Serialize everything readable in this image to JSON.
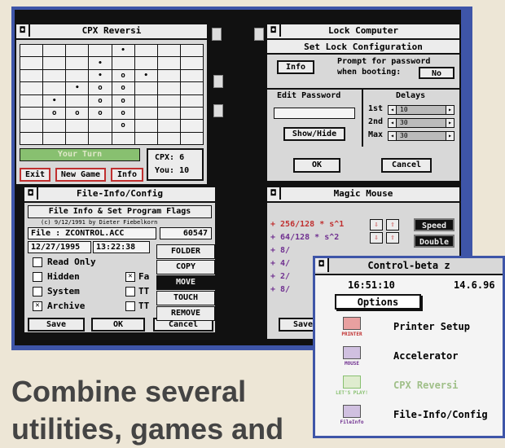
{
  "reversi": {
    "title": "CPX Reversi",
    "board": [
      [
        "",
        "",
        "",
        "",
        "•",
        "",
        "",
        ""
      ],
      [
        "",
        "",
        "",
        "•",
        "",
        "",
        "",
        ""
      ],
      [
        "",
        "",
        "",
        "•",
        "o",
        "•",
        "",
        ""
      ],
      [
        "",
        "",
        "•",
        "o",
        "o",
        "",
        "",
        ""
      ],
      [
        "",
        "•",
        "",
        "o",
        "o",
        "",
        "",
        ""
      ],
      [
        "",
        "o",
        "o",
        "o",
        "o",
        "",
        "",
        ""
      ],
      [
        "",
        "",
        "",
        "",
        "o",
        "",
        "",
        ""
      ],
      [
        "",
        "",
        "",
        "",
        "",
        "",
        "",
        ""
      ]
    ],
    "turn_text": "Your Turn",
    "cpx_score": "CPX: 6",
    "you_score": "You: 10",
    "buttons": {
      "exit": "Exit",
      "new_game": "New Game",
      "info": "Info"
    }
  },
  "lock": {
    "title": "Lock Computer",
    "subtitle": "Set Lock Configuration",
    "info_button": "Info",
    "prompt_line1": "Prompt for password",
    "prompt_line2": "when booting:",
    "prompt_value": "No",
    "edit_password_header": "Edit Password",
    "show_hide_button": "Show/Hide",
    "delays_header": "Delays",
    "delay_rows": [
      {
        "label": "1st",
        "value": "10"
      },
      {
        "label": "2nd",
        "value": "30"
      },
      {
        "label": "Max",
        "value": "30"
      }
    ],
    "ok_button": "OK",
    "cancel_button": "Cancel"
  },
  "fileinfo": {
    "title": "File-Info/Config",
    "subtitle": "File Info & Set Program Flags",
    "copyright": "(c) 9/12/1991 by Dieter Fiebelkorn",
    "file_label": "File : ZCONTROL.ACC",
    "file_size": "60547",
    "date": "12/27/1995",
    "time": "13:22:38",
    "flags": [
      {
        "label": "Read Only",
        "checked": false
      },
      {
        "label": "Hidden",
        "checked": false
      },
      {
        "label": "System",
        "checked": false
      },
      {
        "label": "Archive",
        "checked": true
      }
    ],
    "flags2": [
      {
        "label": "Fa",
        "checked": true
      },
      {
        "label": "TT",
        "checked": false
      },
      {
        "label": "TT",
        "checked": false
      }
    ],
    "save_button": "Save",
    "ok_button": "OK",
    "cancel_button": "Cancel",
    "menu": [
      "FOLDER",
      "COPY",
      "MOVE",
      "TOUCH",
      "REMOVE"
    ],
    "menu_selected": "MOVE"
  },
  "magic": {
    "title": "Magic Mouse",
    "rows": [
      {
        "text": "+ 256/128 * s^1"
      },
      {
        "text": "+  64/128 * s^2"
      },
      {
        "text": "+   8/"
      },
      {
        "text": "+   4/"
      },
      {
        "text": "+   2/"
      },
      {
        "text": "+   8/"
      }
    ],
    "speed_button": "Speed",
    "double_button": "Double",
    "save_button": "Save"
  },
  "control": {
    "title": "Control-beta  z",
    "time": "16:51:10",
    "date": "14.6.96",
    "options_button": "Options",
    "items": [
      {
        "label": "Printer Setup",
        "icon_label": "PRINTER",
        "icon": "printer-icon",
        "dimmed": false
      },
      {
        "label": "Accelerator",
        "icon_label": "MOUSE",
        "icon": "mouse-icon",
        "dimmed": false
      },
      {
        "label": "CPX Reversi",
        "icon_label": "LET'S PLAY!",
        "icon": "reversi-board-icon",
        "dimmed": true
      },
      {
        "label": "File-Info/Config",
        "icon_label": "FileInfo",
        "icon": "file-info-icon",
        "dimmed": false
      }
    ]
  },
  "caption": {
    "line1": "Combine several",
    "line2": "utilities, games and"
  },
  "colors": {
    "frame_blue": "#3e55a8",
    "turn_green": "#88c070",
    "accent_red": "#c03030",
    "page_bg": "#ede6d6"
  }
}
